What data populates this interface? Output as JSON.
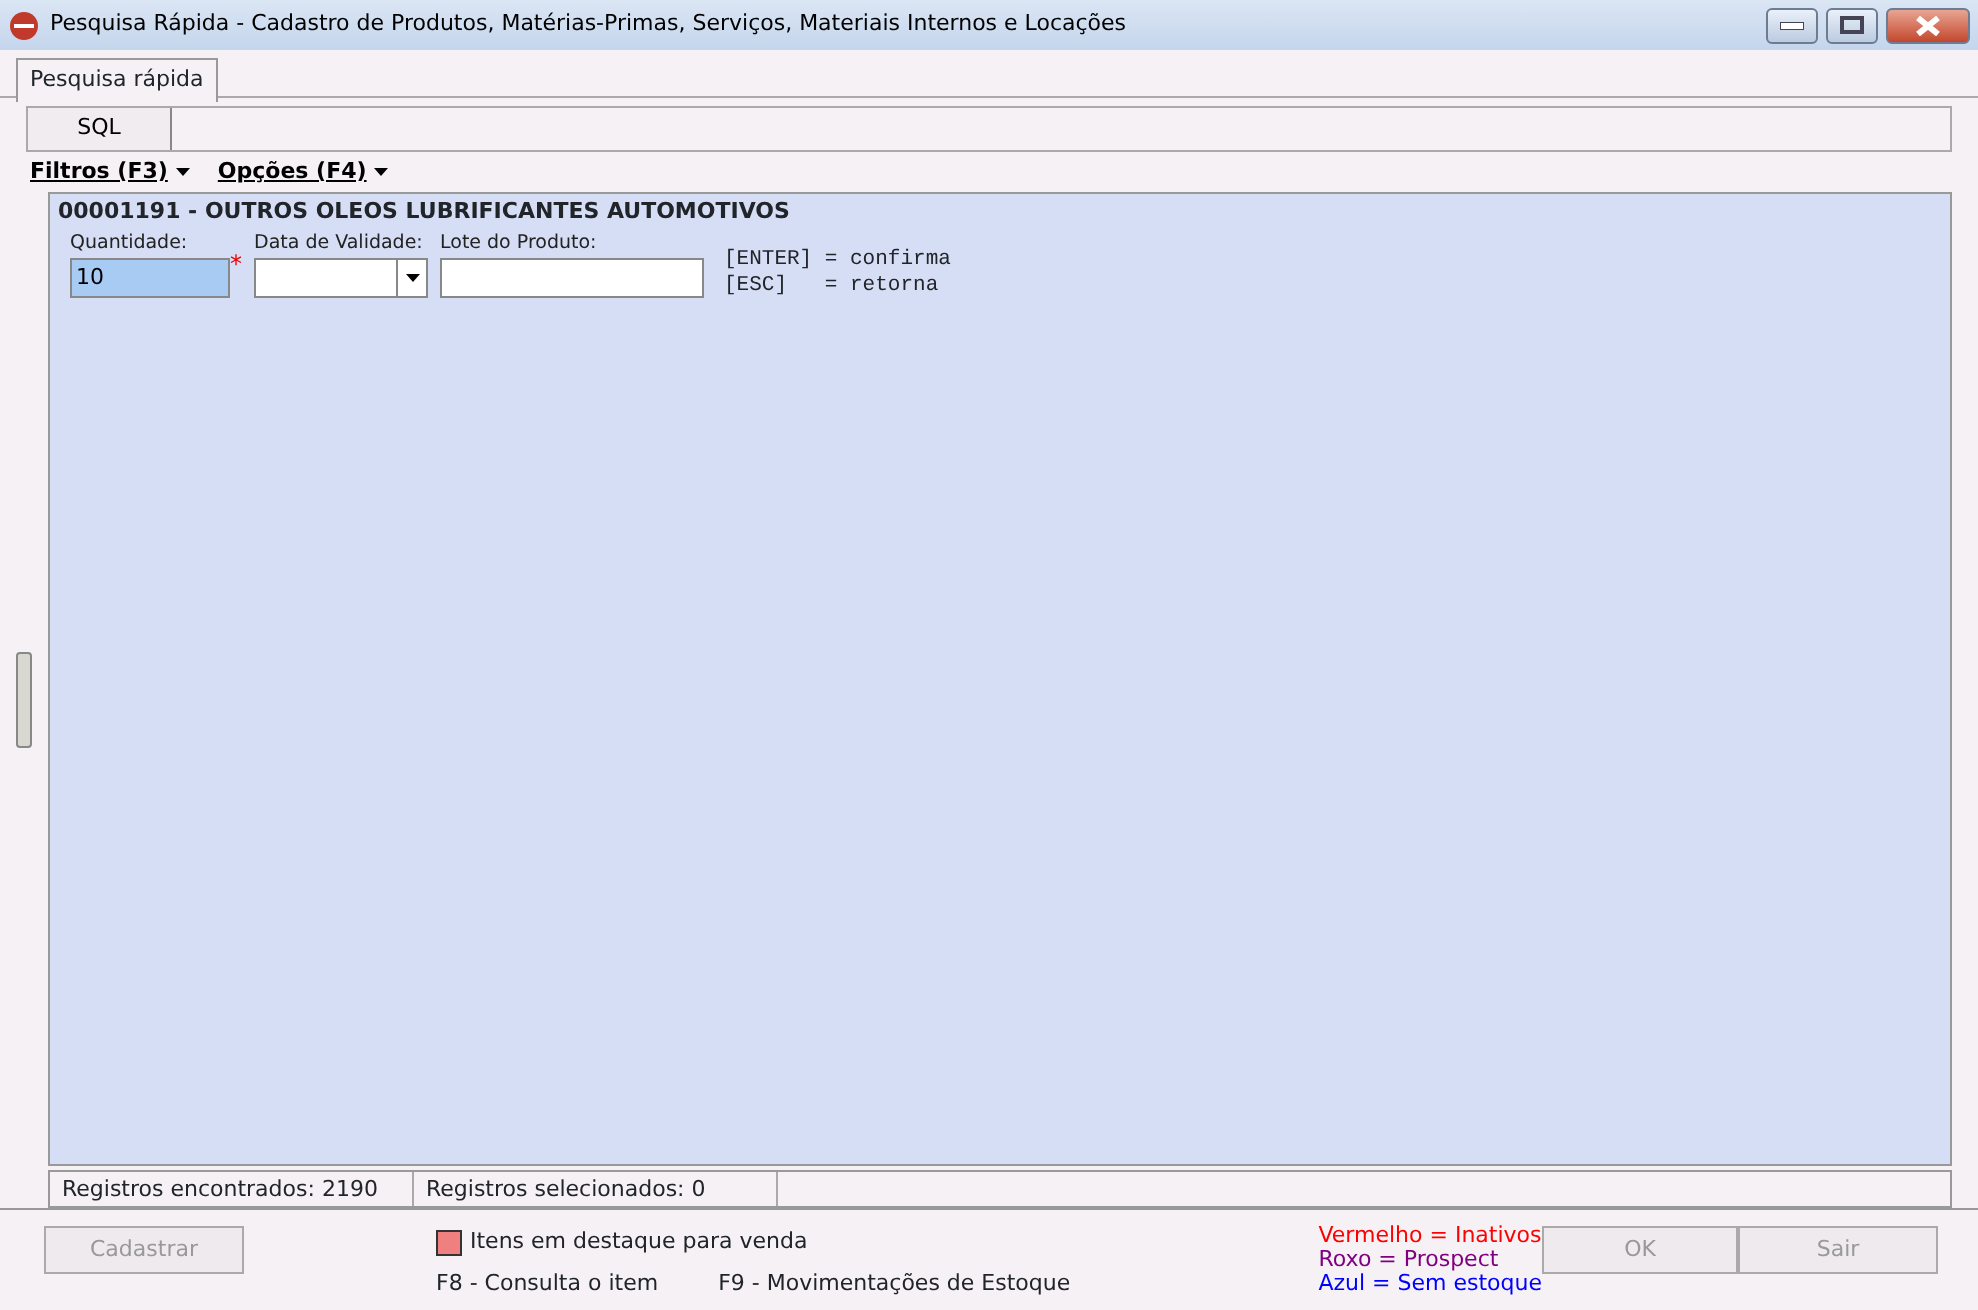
{
  "window": {
    "title": "Pesquisa Rápida - Cadastro de Produtos, Matérias-Primas, Serviços, Materiais Internos e Locações"
  },
  "tabs": [
    {
      "label": "Pesquisa rápida",
      "selected": true
    }
  ],
  "sql_button": "SQL",
  "menus": [
    {
      "label": "Filtros (F3)"
    },
    {
      "label": "Opções (F4)"
    }
  ],
  "product": {
    "title": "00001191 - OUTROS OLEOS LUBRIFICANTES AUTOMOTIVOS"
  },
  "fields": [
    {
      "kind": "text",
      "label": "Quantidade:",
      "value": "10",
      "required_mark": "*",
      "focused": true
    },
    {
      "kind": "date",
      "label": "Data de Validade:",
      "focused": false
    },
    {
      "kind": "text",
      "label": "Lote do Produto:",
      "focused": false
    }
  ],
  "hints": [
    "[ENTER] = confirma",
    "[ESC]   = retorna"
  ],
  "status_bar": [
    "Registros encontrados: 2190",
    "Registros selecionados: 0"
  ],
  "buttons": [
    {
      "label": "Cadastrar",
      "disabled": true
    },
    {
      "label": "OK",
      "disabled": true
    },
    {
      "label": "Sair",
      "disabled": true
    }
  ],
  "highlight_legend": {
    "label": "Itens em destaque para venda",
    "color": "#f08080"
  },
  "shortcuts": [
    "F8 - Consulta o item",
    "F9 - Movimentações de Estoque"
  ],
  "legend": [
    {
      "label": "Vermelho = Inativos",
      "color": "#ff0000"
    },
    {
      "label": "Roxo = Prospect",
      "color": "#800080"
    },
    {
      "label": "Azul = Sem estoque",
      "color": "#0000ff"
    }
  ]
}
